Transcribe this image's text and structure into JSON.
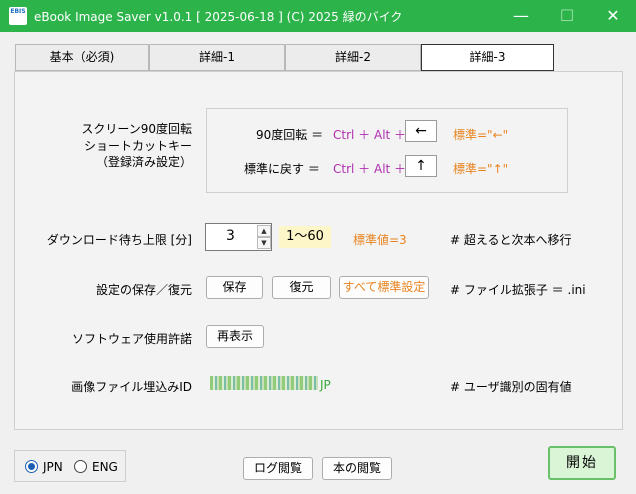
{
  "window": {
    "app_icon_text": "EBIS",
    "title": "eBook Image Saver  v1.0.1  [ 2025-06-18 ]   (C) 2025 緑のバイク",
    "minimize": "—",
    "maximize": "☐",
    "close": "✕"
  },
  "tabs": [
    {
      "label": "基本（必須)"
    },
    {
      "label": "詳細-1"
    },
    {
      "label": "詳細-2"
    },
    {
      "label": "詳細-3"
    }
  ],
  "shortcut": {
    "section_label_1": "スクリーン90度回転",
    "section_label_2": "ショートカットキー",
    "section_label_3": "（登録済み設定）",
    "rotate_label": "90度回転 ＝",
    "rotate_combo": "Ctrl ＋ Alt ＋",
    "rotate_key": "←",
    "rotate_default": "標準=\"←\"",
    "reset_label": "標準に戻す ＝",
    "reset_combo": "Ctrl ＋ Alt ＋",
    "reset_key": "↑",
    "reset_default": "標準=\"↑\""
  },
  "download_limit": {
    "label": "ダウンロード待ち上限 [分]",
    "value": "3",
    "range": "1～60",
    "default": "標準値=3",
    "note": "# 超えると次本へ移行"
  },
  "settings_io": {
    "label": "設定の保存／復元",
    "save_label": "保存",
    "restore_label": "復元",
    "reset_all_label": "すべて標準設定",
    "note": "# ファイル拡張子 ＝ .ini"
  },
  "license": {
    "label": "ソフトウェア使用許諾",
    "redisplay_label": "再表示"
  },
  "embed_id": {
    "label": "画像ファイル埋込みID",
    "value_suffix": "JP",
    "note": "# ユーザ識別の固有値"
  },
  "language": {
    "jpn_label": "JPN",
    "eng_label": "ENG",
    "selected": "JPN"
  },
  "footer": {
    "log_label": "ログ閲覧",
    "book_label": "本の閲覧",
    "start_label": "開始"
  },
  "colors": {
    "titlebar": "#2cb34a",
    "accent_purple": "#b02fb0",
    "accent_orange": "#e8831e",
    "start_bg": "#d9f5d6"
  }
}
